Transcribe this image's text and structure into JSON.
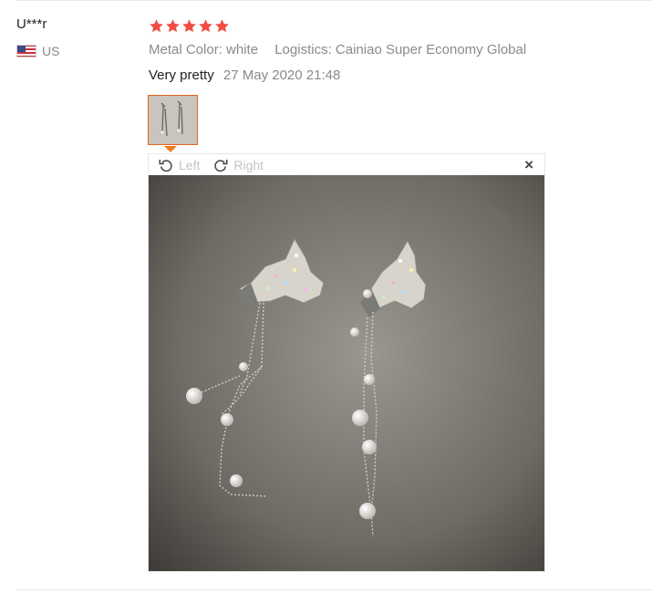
{
  "review": {
    "buyer": {
      "name": "U***r",
      "country": "US",
      "flag_icon": "us-flag-icon"
    },
    "rating": {
      "stars": 5,
      "max": 5,
      "color": "#f04e45"
    },
    "attributes": [
      "Metal Color: white",
      "Logistics: Cainiao Super Economy Global"
    ],
    "feedback_text": "Very pretty",
    "date": "27 May 2020 21:48",
    "images": [
      {
        "icon": "earrings-photo",
        "selected": true
      }
    ]
  },
  "viewer": {
    "rotate_left_label": "Left",
    "rotate_right_label": "Right",
    "close_label": "×"
  },
  "colors": {
    "accent": "#f07c1e",
    "star": "#f04e45",
    "muted_text": "#8a8a8a"
  }
}
